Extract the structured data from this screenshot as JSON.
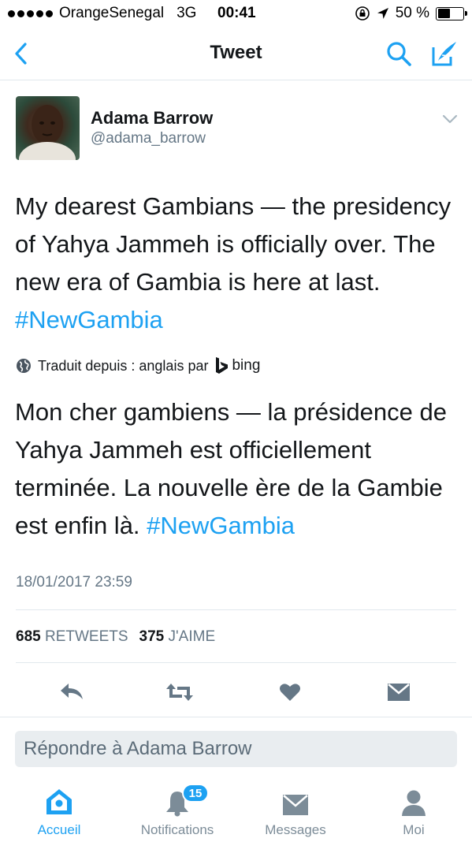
{
  "status_bar": {
    "carrier": "OrangeSenegal",
    "network": "3G",
    "time": "00:41",
    "battery": "50 %",
    "battery_level": 0.5
  },
  "nav": {
    "title": "Tweet"
  },
  "tweet": {
    "author_name": "Adama Barrow",
    "author_handle": "@adama_barrow",
    "text": "My dearest Gambians — the presidency of Yahya Jammeh is officially over. The new era of Gambia is here at last.",
    "hashtag": "#NewGambia",
    "translation_label": "Traduit depuis : anglais par",
    "translation_provider": "bing",
    "translated_text": "Mon cher gambiens — la présidence de Yahya Jammeh est officiellement terminée. La nouvelle ère de la Gambie est enfin là.",
    "timestamp": "18/01/2017 23:59",
    "retweets_count": "685",
    "retweets_label": "RETWEETS",
    "likes_count": "375",
    "likes_label": "J'AIME"
  },
  "reply": {
    "placeholder": "Répondre à Adama Barrow"
  },
  "tab_bar": {
    "items": [
      {
        "label": "Accueil",
        "icon": "home-icon",
        "active": true
      },
      {
        "label": "Notifications",
        "icon": "bell-icon",
        "badge": "15"
      },
      {
        "label": "Messages",
        "icon": "envelope-icon"
      },
      {
        "label": "Moi",
        "icon": "person-icon"
      }
    ]
  },
  "colors": {
    "accent": "#1da1f2",
    "text": "#14171a",
    "muted": "#657786",
    "divider": "#e1e8ed"
  }
}
